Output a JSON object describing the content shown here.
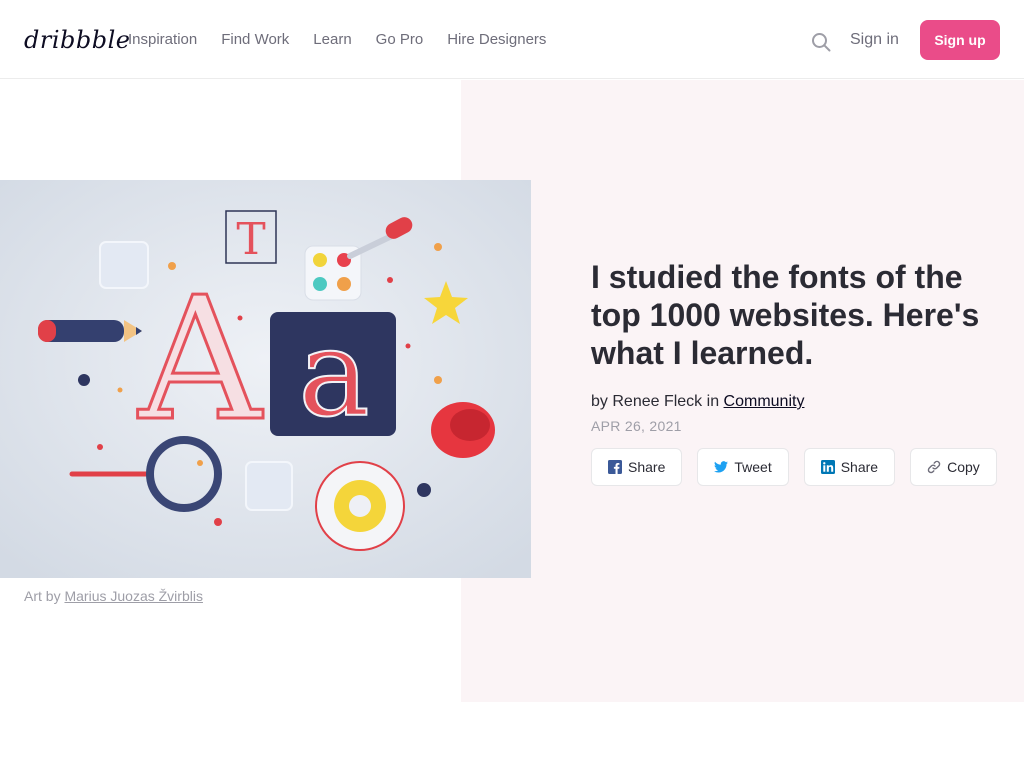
{
  "header": {
    "logo": "dribbble",
    "nav": [
      "Inspiration",
      "Find Work",
      "Learn",
      "Go Pro",
      "Hire Designers"
    ],
    "sign_in": "Sign in",
    "sign_up": "Sign up"
  },
  "hero": {
    "image_alt": "3D typography illustration",
    "art_credit_prefix": "Art by",
    "art_credit_name": "Marius Juozas Žvirblis",
    "title": "I studied the fonts of the top 1000 websites. Here's what I learned.",
    "by": "by",
    "author": "Renee Fleck",
    "in": "in",
    "category": "Community",
    "date": "APR 26, 2021"
  },
  "share": [
    {
      "label": "Share",
      "icon": "facebook-icon"
    },
    {
      "label": "Tweet",
      "icon": "twitter-icon"
    },
    {
      "label": "Share",
      "icon": "linkedin-icon"
    },
    {
      "label": "Copy",
      "icon": "link-icon"
    }
  ],
  "colors": {
    "brand": "#ea4c89",
    "panel": "#fbf4f6",
    "text": "#2b2b34",
    "muted": "#9e9ea7"
  }
}
